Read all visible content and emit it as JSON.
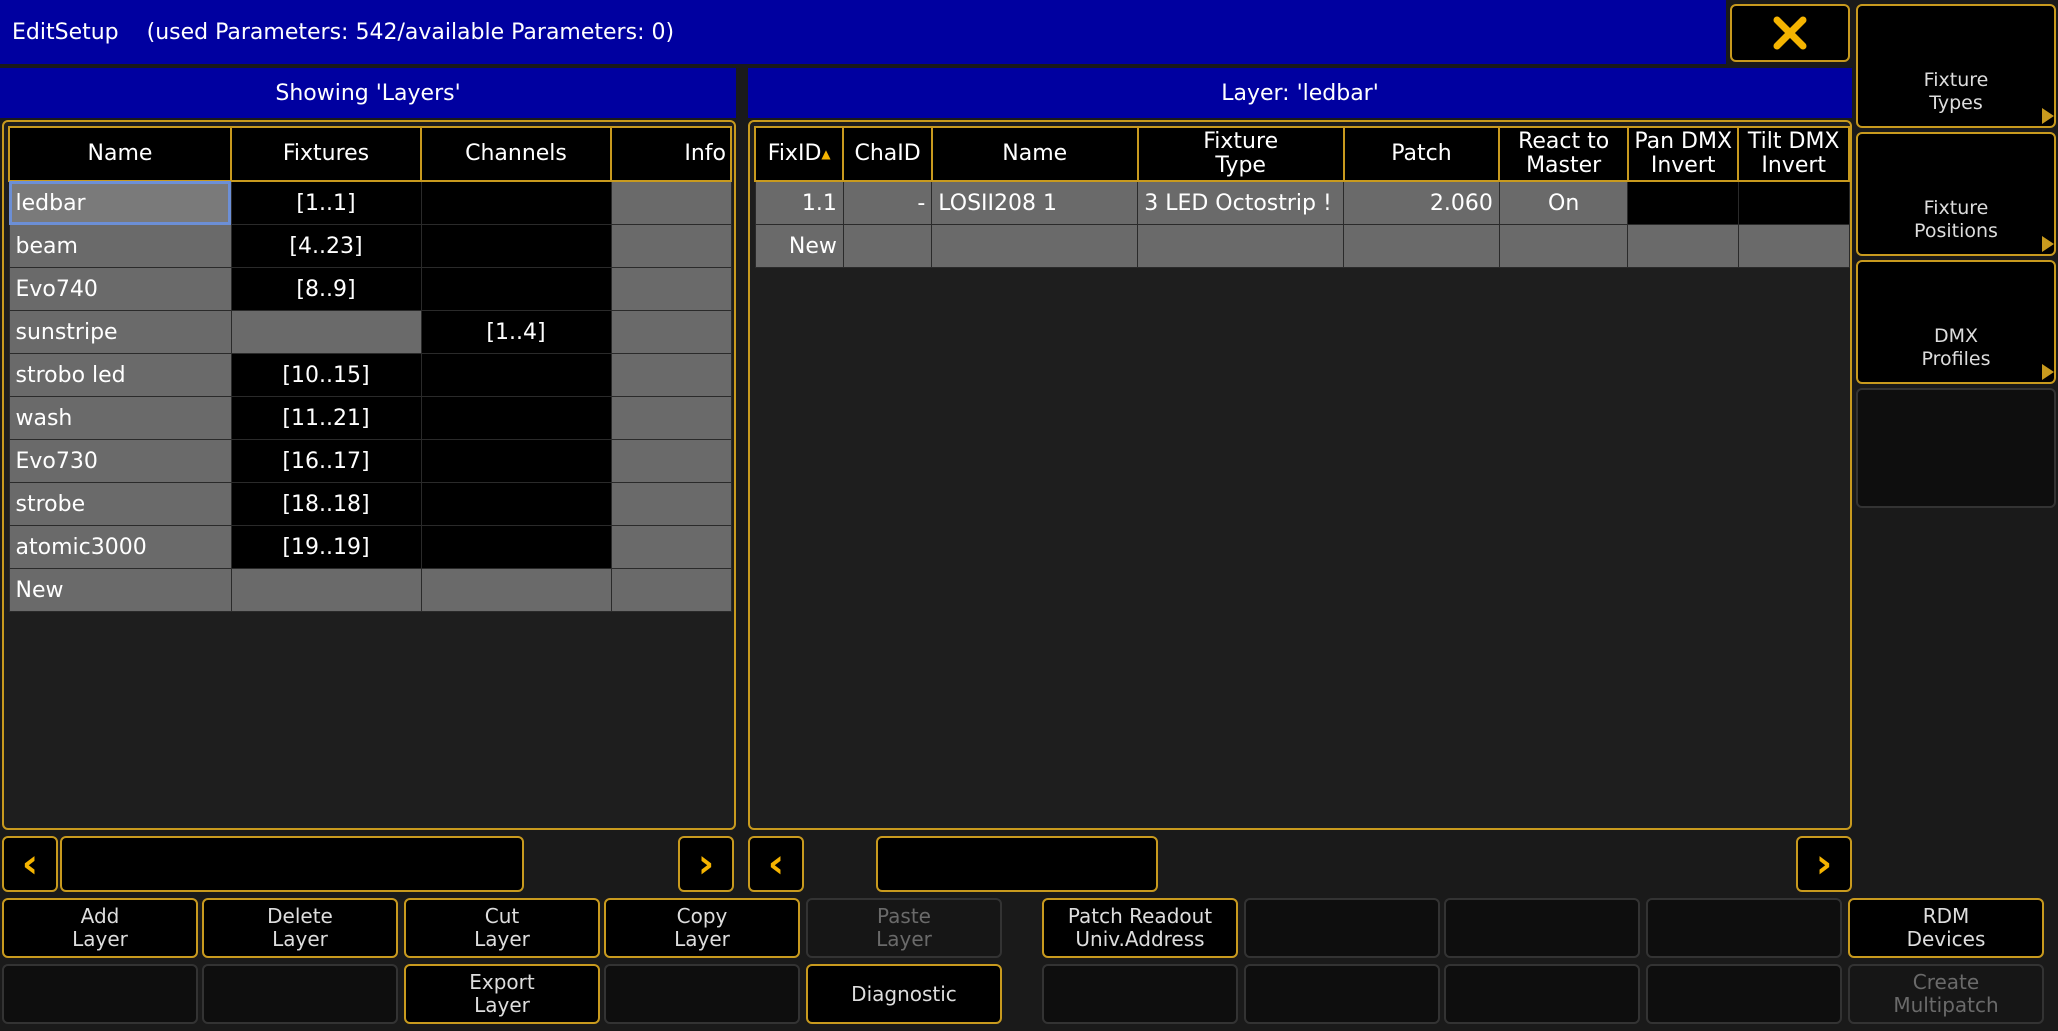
{
  "title": {
    "name": "EditSetup",
    "params": "(used Parameters: 542/available Parameters: 0)"
  },
  "close_icon": "close-icon",
  "left_panel": {
    "header": "Showing 'Layers'",
    "columns": [
      "Name",
      "Fixtures",
      "Channels",
      "Info"
    ],
    "rows": [
      {
        "name": "ledbar",
        "fixtures": "[1..1]",
        "channels": ""
      },
      {
        "name": "beam",
        "fixtures": "[4..23]",
        "channels": ""
      },
      {
        "name": "Evo740",
        "fixtures": "[8..9]",
        "channels": ""
      },
      {
        "name": "sunstripe",
        "fixtures": "",
        "channels": "[1..4]"
      },
      {
        "name": "strobo led",
        "fixtures": "[10..15]",
        "channels": ""
      },
      {
        "name": "wash",
        "fixtures": "[11..21]",
        "channels": ""
      },
      {
        "name": "Evo730",
        "fixtures": "[16..17]",
        "channels": ""
      },
      {
        "name": "strobe",
        "fixtures": "[18..18]",
        "channels": ""
      },
      {
        "name": "atomic3000",
        "fixtures": "[19..19]",
        "channels": ""
      }
    ],
    "new_label": "New"
  },
  "right_panel": {
    "header": "Layer: 'ledbar'",
    "columns": [
      "FixID",
      "ChaID",
      "Name",
      "Fixture\nType",
      "Patch",
      "React to\nMaster",
      "Pan DMX\nInvert",
      "Tilt DMX\nInvert"
    ],
    "row": {
      "fixid": "1.1",
      "chaid": "-",
      "name": "LOSII208 1",
      "fixture_type": "3 LED Octostrip !",
      "patch": "2.060",
      "react": "On"
    },
    "new_label": "New"
  },
  "side_buttons": [
    {
      "label": "Fixture\nTypes"
    },
    {
      "label": "Fixture\nPositions"
    },
    {
      "label": "DMX\nProfiles"
    }
  ],
  "bottom": {
    "add_layer": "Add\nLayer",
    "delete_layer": "Delete\nLayer",
    "cut_layer": "Cut\nLayer",
    "copy_layer": "Copy\nLayer",
    "paste_layer": "Paste\nLayer",
    "patch_readout": "Patch Readout\nUniv.Address",
    "rdm_devices": "RDM\nDevices",
    "export_layer": "Export\nLayer",
    "diagnostic": "Diagnostic",
    "create_multipatch": "Create\nMultipatch"
  }
}
